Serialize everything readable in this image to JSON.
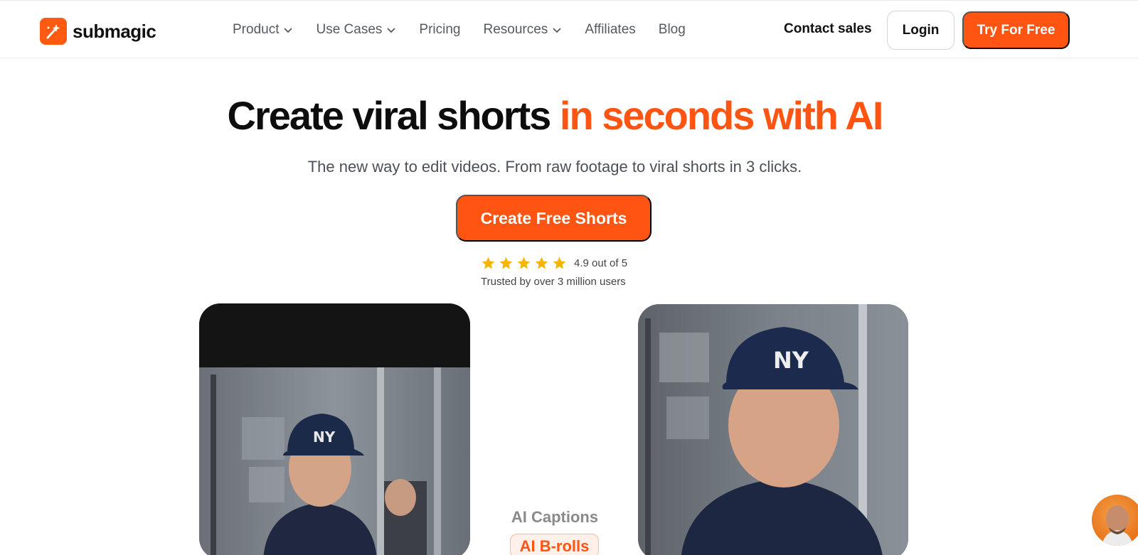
{
  "brand": {
    "name": "submagic",
    "accent_color": "#ff5412"
  },
  "nav": {
    "items": [
      {
        "label": "Product",
        "has_dropdown": true
      },
      {
        "label": "Use Cases",
        "has_dropdown": true
      },
      {
        "label": "Pricing",
        "has_dropdown": false
      },
      {
        "label": "Resources",
        "has_dropdown": true
      },
      {
        "label": "Affiliates",
        "has_dropdown": false
      },
      {
        "label": "Blog",
        "has_dropdown": false
      }
    ],
    "contact_label": "Contact sales",
    "login_label": "Login",
    "try_label": "Try For Free"
  },
  "hero": {
    "headline_main": "Create viral shorts ",
    "headline_accent": "in seconds with AI",
    "subheadline": "The new way to edit videos. From raw footage to viral shorts in 3 clicks.",
    "cta_label": "Create Free Shorts",
    "rating": {
      "stars": 5,
      "text": "4.9 out of 5"
    },
    "trusted_text": "Trusted by over 3 million users"
  },
  "features": {
    "item_1": "AI Captions",
    "item_2": "AI B-rolls"
  },
  "icons": {
    "logo": "magic-wand-icon",
    "dropdown": "chevron-down-icon",
    "star": "star-icon",
    "chat": "chat-avatar-icon"
  }
}
